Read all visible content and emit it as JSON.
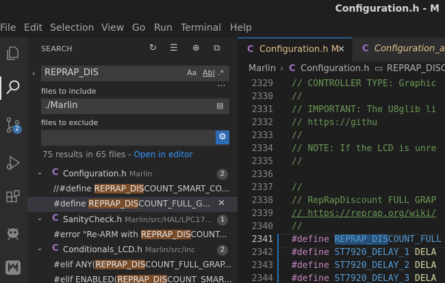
{
  "window": {
    "title": "Configuration.h - M"
  },
  "menu": [
    "File",
    "Edit",
    "Selection",
    "View",
    "Go",
    "Run",
    "Terminal",
    "Help"
  ],
  "activity": {
    "source_control_badge": "2"
  },
  "sidebar": {
    "title": "SEARCH",
    "search": {
      "value": "REPRAP_DIS",
      "opt_case": "Aa",
      "opt_word": "Ab|",
      "opt_regex": ".*"
    },
    "include_label": "files to include",
    "include_value": "./Marlin",
    "exclude_label": "files to exclude",
    "exclude_value": "",
    "more": "···",
    "summary": "75 results in 65 files - ",
    "summary_link": "Open in editor",
    "results": [
      {
        "file": "Configuration.h",
        "path": "Marlin",
        "count": "2",
        "matches": [
          {
            "pre": "//#define ",
            "hit": "REPRAP_DIS",
            "post": "COUNT_SMART_CO..."
          },
          {
            "pre": "#define ",
            "hit": "REPRAP_DIS",
            "post": "COUNT_FULL_G..."
          }
        ]
      },
      {
        "file": "SanityCheck.h",
        "path": "Marlin/src/HAL/LPC17...",
        "count": "1",
        "matches": [
          {
            "pre": "#error \"Re-ARM with ",
            "hit": "REPRAP_DIS",
            "post": "COUNT..."
          }
        ]
      },
      {
        "file": "Conditionals_LCD.h",
        "path": "Marlin/src/inc",
        "count": "2",
        "matches": [
          {
            "pre": "#elif ANY(",
            "hit": "REPRAP_DIS",
            "post": "COUNT_FULL_GRAP..."
          },
          {
            "pre": "#elif ENABLED(",
            "hit": "REPRAP_DIS",
            "post": "COUNT_SMAR..."
          }
        ]
      }
    ]
  },
  "editor": {
    "tabs": [
      {
        "label": "Configuration.h",
        "modified": "M",
        "close": "✕"
      },
      {
        "label": "Configuration_adv"
      }
    ],
    "breadcrumb": [
      "Marlin",
      "Configuration.h",
      "REPRAP_DISC"
    ],
    "lines": [
      {
        "n": "2329",
        "t": "// CONTROLLER TYPE: Graphic"
      },
      {
        "n": "2330",
        "t": "//"
      },
      {
        "n": "2331",
        "t": "// IMPORTANT: The U8glib li"
      },
      {
        "n": "2332",
        "t": "//            https://githu"
      },
      {
        "n": "2333",
        "t": "//"
      },
      {
        "n": "2334",
        "t": "// NOTE: If the LCD is unre"
      },
      {
        "n": "2335",
        "t": "//"
      },
      {
        "n": "2336",
        "t": ""
      },
      {
        "n": "2337",
        "t": "//"
      },
      {
        "n": "2338",
        "t": "// RepRapDiscount FULL GRAP"
      },
      {
        "n": "2339",
        "t": "// https://reprap.org/wiki/"
      },
      {
        "n": "2340",
        "t": "//"
      }
    ],
    "define_lines": [
      {
        "n": "2341",
        "kw": "#define",
        "sel": "REPRAP_DIS",
        "rest": "COUNT_FULL"
      },
      {
        "n": "2342",
        "kw": "#define",
        "name": "ST7920_DELAY_1",
        "rest": "DELA"
      },
      {
        "n": "2343",
        "kw": "#define",
        "name": "ST7920_DELAY_2",
        "rest": "DELA"
      },
      {
        "n": "2344",
        "kw": "#define",
        "name": "ST7920_DELAY_3",
        "rest": "DELA"
      }
    ]
  }
}
